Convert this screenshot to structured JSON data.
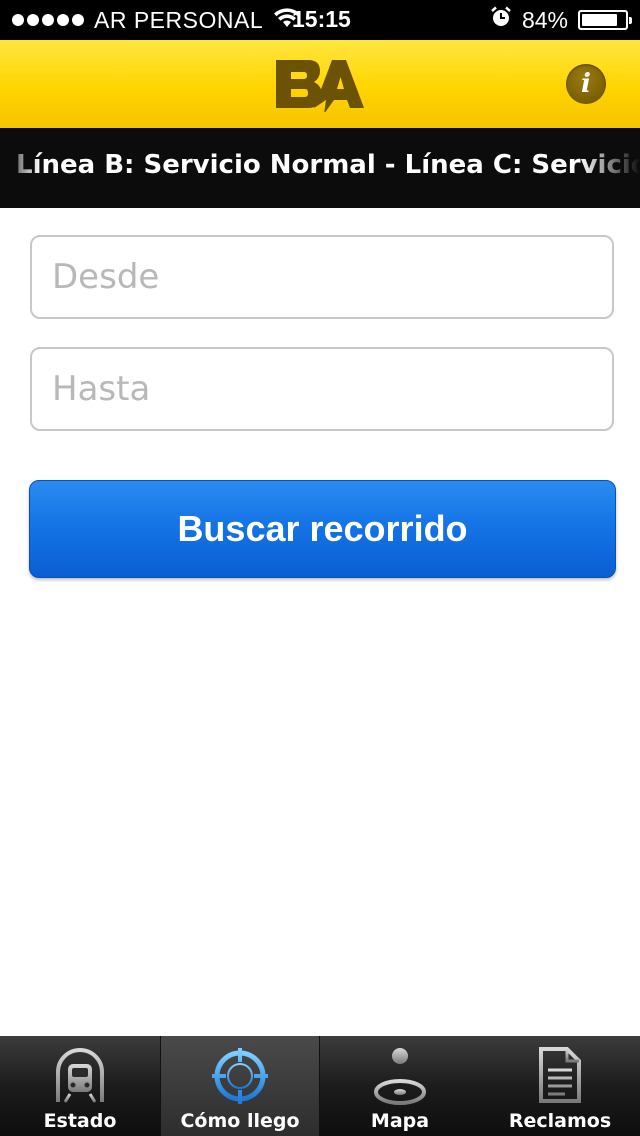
{
  "status_bar": {
    "signal_dots": 5,
    "carrier": "AR PERSONAL",
    "time": "15:15",
    "battery_percent_label": "84%",
    "battery_level": 0.84
  },
  "header": {
    "logo_text": "BA",
    "info_label": "i",
    "brand_color": "#ffd400"
  },
  "ticker": {
    "text": "Línea B: Servicio Normal - Línea C: Servicio Normal"
  },
  "form": {
    "from_placeholder": "Desde",
    "to_placeholder": "Hasta",
    "search_label": "Buscar recorrido",
    "button_color": "#1574e6"
  },
  "tabs": [
    {
      "label": "Estado",
      "icon": "train-icon",
      "selected": false
    },
    {
      "label": "Cómo llego",
      "icon": "crosshair-icon",
      "selected": true
    },
    {
      "label": "Mapa",
      "icon": "map-pin-icon",
      "selected": false
    },
    {
      "label": "Reclamos",
      "icon": "document-icon",
      "selected": false
    }
  ]
}
